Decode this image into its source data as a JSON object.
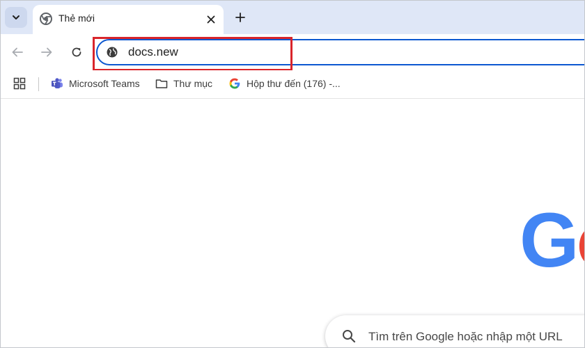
{
  "tab": {
    "title": "Thẻ mới"
  },
  "toolbar": {
    "address_value": "docs.new"
  },
  "bookmarks": {
    "items": [
      {
        "label": "Microsoft Teams",
        "icon": "teams-icon"
      },
      {
        "label": "Thư mục",
        "icon": "folder-icon"
      },
      {
        "label": "Hộp thư đến (176) -...",
        "icon": "google-icon"
      }
    ]
  },
  "content": {
    "logo_partial": "Go",
    "search_placeholder": "Tìm trên Google hoặc nhập một URL"
  },
  "colors": {
    "accent": "#0b57d0",
    "highlight_box": "#d9252b",
    "tabstrip": "#dfe7f7",
    "google_blue": "#4285f4",
    "google_red": "#ea4335"
  }
}
